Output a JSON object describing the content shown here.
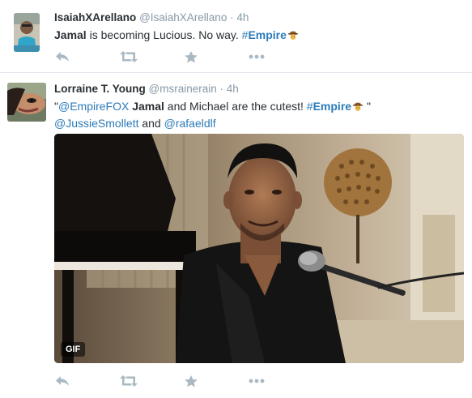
{
  "tweets": [
    {
      "fullname": "IsaiahXArellano",
      "username": "@IsaiahXArellano",
      "separator": "·",
      "time": "4h",
      "text": {
        "bold_name": "Jamal",
        "body": " is becoming Lucious. No way. ",
        "hashtag_symbol": "#",
        "hashtag": "Empire"
      }
    },
    {
      "fullname": "Lorraine T. Young",
      "username": "@msrainerain",
      "separator": "·",
      "time": "4h",
      "text": {
        "open_quote": "\"",
        "mention1": "@EmpireFOX",
        "space1": " ",
        "bold_name": "Jamal",
        "body": " and Michael are the cutest! ",
        "hashtag_symbol": "#",
        "hashtag": "Empire",
        "close_quote": " \"",
        "mention2": "@JussieSmollett",
        "and": " and ",
        "mention3": "@rafaeldlf"
      },
      "media_badge": "GIF"
    }
  ],
  "icons": {
    "reply": "reply-icon",
    "retweet": "retweet-icon",
    "favorite": "star-icon",
    "more": "more-icon",
    "emoji": "cowboy-hat-emoji"
  },
  "colors": {
    "link": "#2b7bb9",
    "muted": "#8899a6",
    "action": "#aab8c2",
    "text": "#292f33"
  }
}
